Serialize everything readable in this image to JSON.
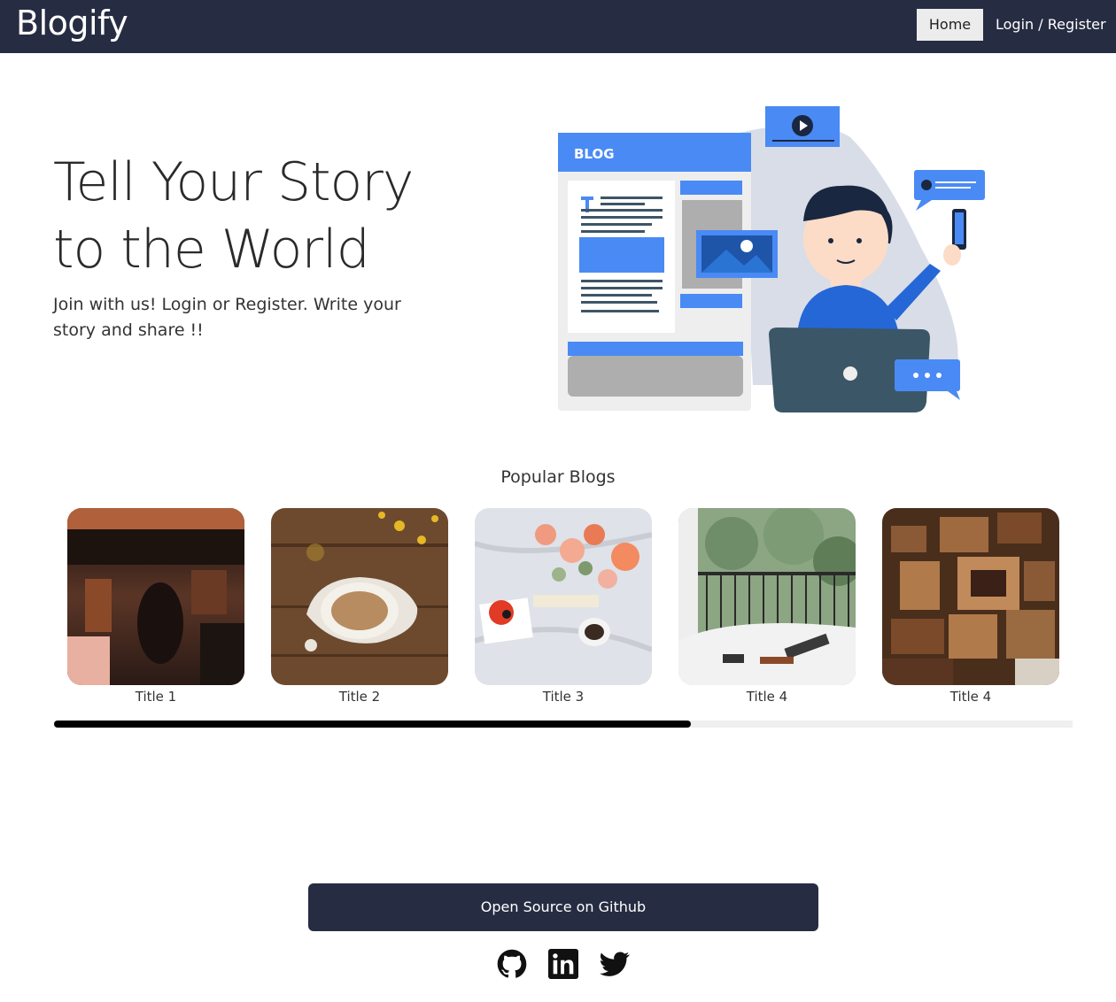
{
  "navbar": {
    "brand": "Blogify",
    "home_label": "Home",
    "login_label": "Login / Register"
  },
  "hero": {
    "title": "Tell Your Story to the World",
    "subtitle": "Join with us! Login or Register. Write your story and share !!",
    "illustration_badge": "BLOG"
  },
  "popular": {
    "heading": "Popular Blogs",
    "cards": [
      {
        "title": "Title 1",
        "image": "cafe-photo"
      },
      {
        "title": "Title 2",
        "image": "coffee-cup-photo"
      },
      {
        "title": "Title 3",
        "image": "flowers-bed-photo"
      },
      {
        "title": "Title 4",
        "image": "balcony-laptop-photo"
      },
      {
        "title": "Title 4",
        "image": "vintage-cameras-photo"
      }
    ],
    "scroll_progress": 0.625
  },
  "footer": {
    "github_button": "Open Source on Github",
    "icons": [
      "github-icon",
      "linkedin-icon",
      "twitter-icon"
    ]
  },
  "colors": {
    "navbar": "#262d42",
    "accent_blue": "#4a8af4",
    "scroll_thumb": "#000000"
  }
}
